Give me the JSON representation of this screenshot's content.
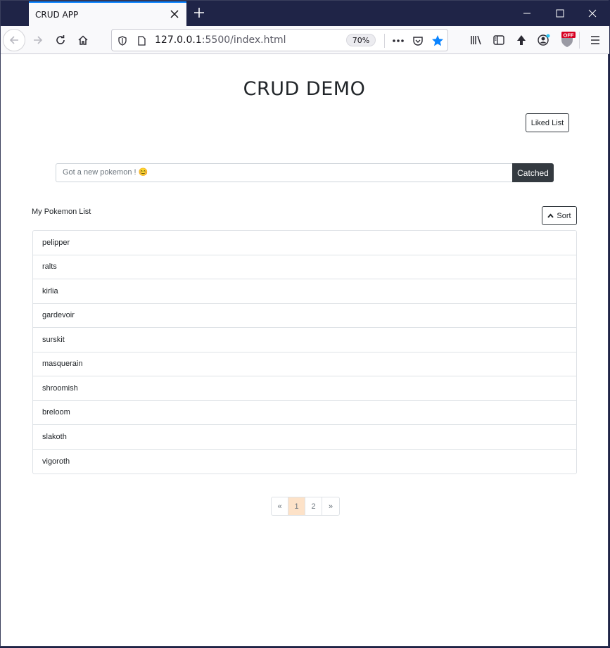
{
  "browser": {
    "tab_title": "CRUD APP",
    "url_host": "127.0.0.1",
    "url_rest": ":5500/index.html",
    "zoom": "70%",
    "accent_color": "#0a84ff"
  },
  "page": {
    "title": "CRUD DEMO",
    "liked_button": "Liked List",
    "input_placeholder": "Got a new pokemon ! 😊",
    "add_button": "Catched",
    "list_heading": "My Pokemon List",
    "sort_button": "Sort",
    "pokemon": [
      "pelipper",
      "ralts",
      "kirlia",
      "gardevoir",
      "surskit",
      "masquerain",
      "shroomish",
      "breloom",
      "slakoth",
      "vigoroth"
    ],
    "pagination": {
      "prev": "«",
      "pages": [
        "1",
        "2"
      ],
      "next": "»",
      "current": "1"
    }
  }
}
